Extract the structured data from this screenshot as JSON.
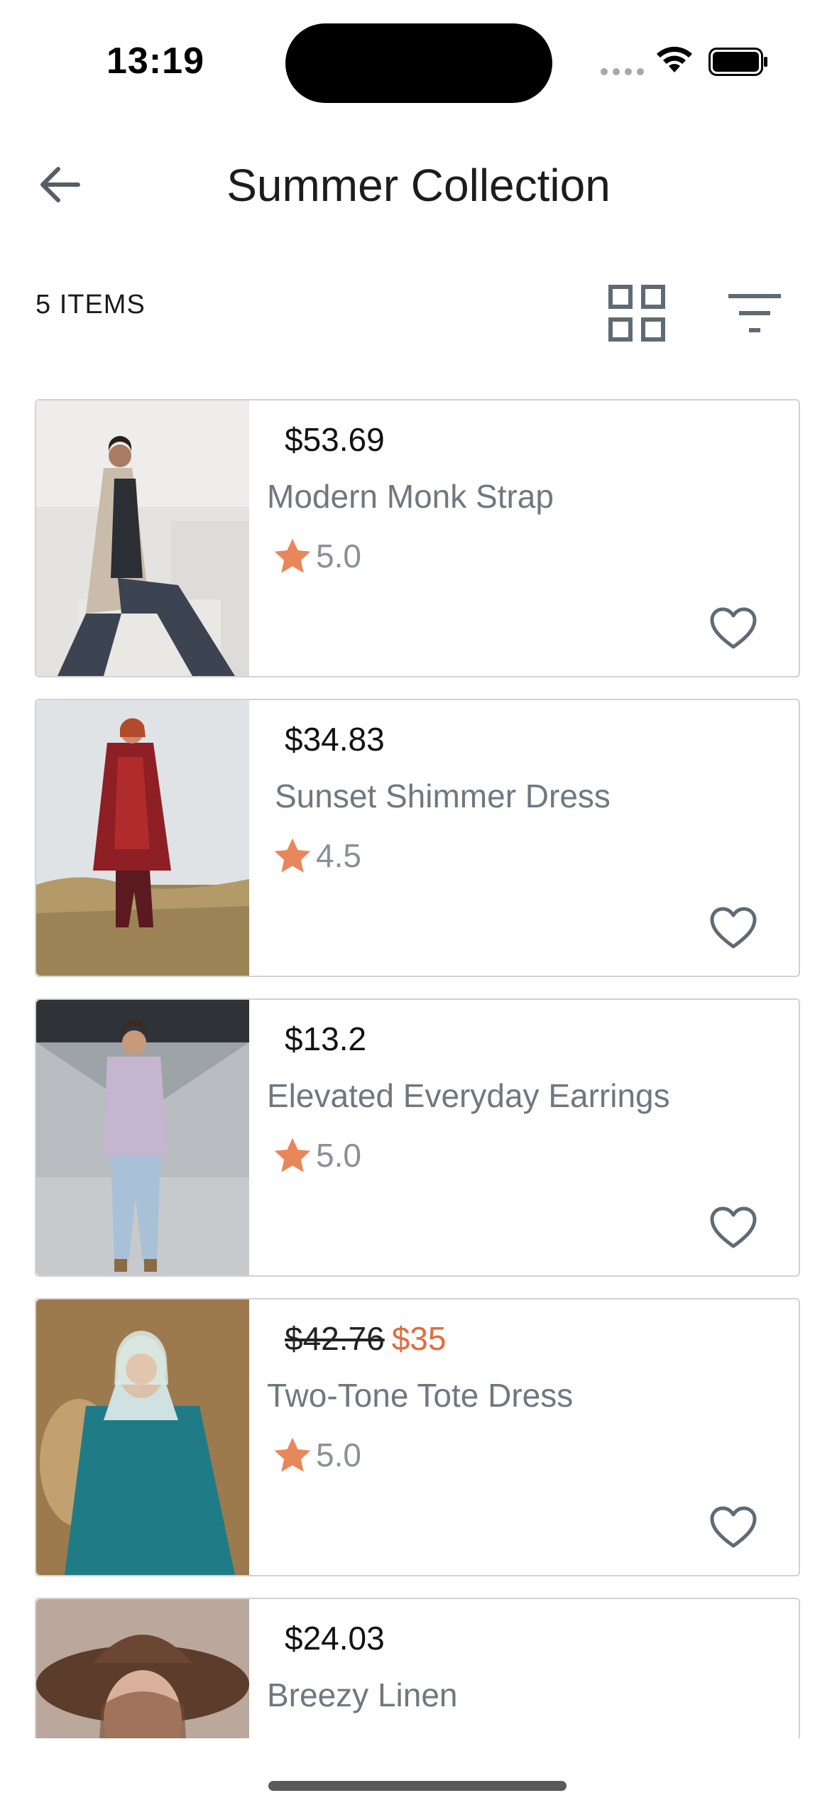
{
  "status_bar": {
    "time": "13:19"
  },
  "header": {
    "title": "Summer Collection"
  },
  "toolbar": {
    "item_count": "5 ITEMS"
  },
  "colors": {
    "accent_star": "#e8875a",
    "sale": "#e46b3c",
    "muted_text": "#6f7880"
  },
  "products": [
    {
      "price": "$53.69",
      "name": "Modern Monk Strap",
      "rating": "5.0"
    },
    {
      "price": "$34.83",
      "name": "Sunset Shimmer Dress",
      "rating": "4.5"
    },
    {
      "price": "$13.2",
      "name": "Elevated Everyday Earrings",
      "rating": "5.0"
    },
    {
      "old_price": "$42.76",
      "sale_price": "$35",
      "name": "Two-Tone Tote Dress",
      "rating": "5.0"
    },
    {
      "price": "$24.03",
      "name": "Breezy Linen",
      "rating": ""
    }
  ]
}
